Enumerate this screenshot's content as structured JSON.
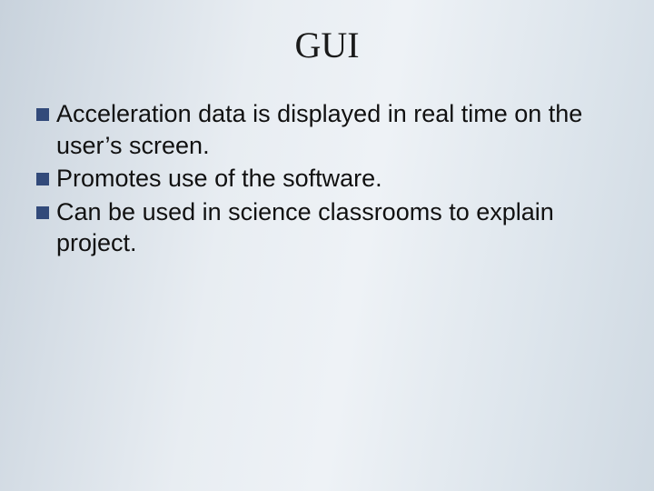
{
  "title": "GUI",
  "bullets": [
    {
      "text": "Acceleration data is displayed in real time on the user’s screen."
    },
    {
      "text": "Promotes use of the software."
    },
    {
      "text": "Can be used in science classrooms to explain project."
    }
  ]
}
